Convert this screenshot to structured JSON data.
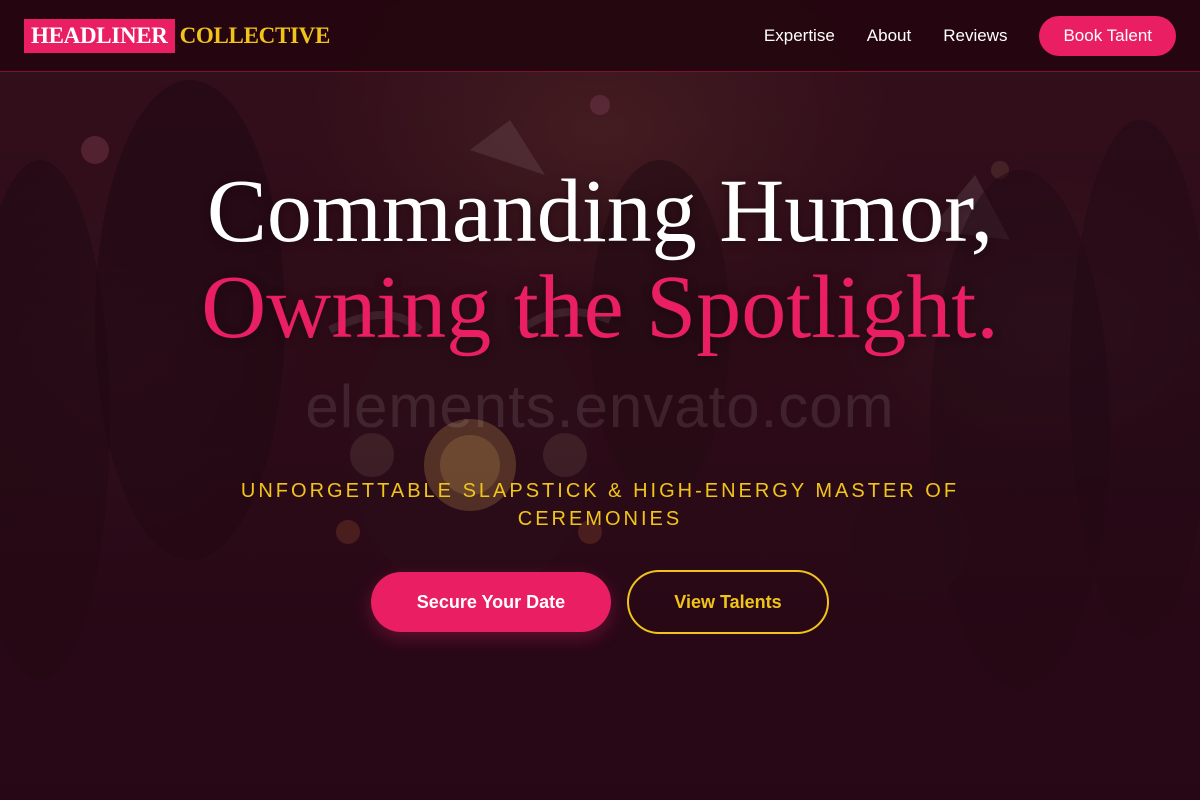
{
  "header": {
    "logo_primary": "HEADLINER",
    "logo_secondary": "COLLECTIVE",
    "nav": [
      "Expertise",
      "About",
      "Reviews"
    ],
    "cta_label": "Book Talent"
  },
  "hero": {
    "headline_line1": "Commanding Humor,",
    "headline_accent": "Owning the Spotlight.",
    "subtitle": "Unforgettable Slapstick & High-Energy Master of Ceremonies",
    "primary_button": "Secure Your Date",
    "secondary_button": "View Talents",
    "watermark": "elements.envato.com"
  },
  "colors": {
    "accent_pink": "#e91e63",
    "accent_gold": "#f0c419",
    "background": "#2a0a14"
  }
}
